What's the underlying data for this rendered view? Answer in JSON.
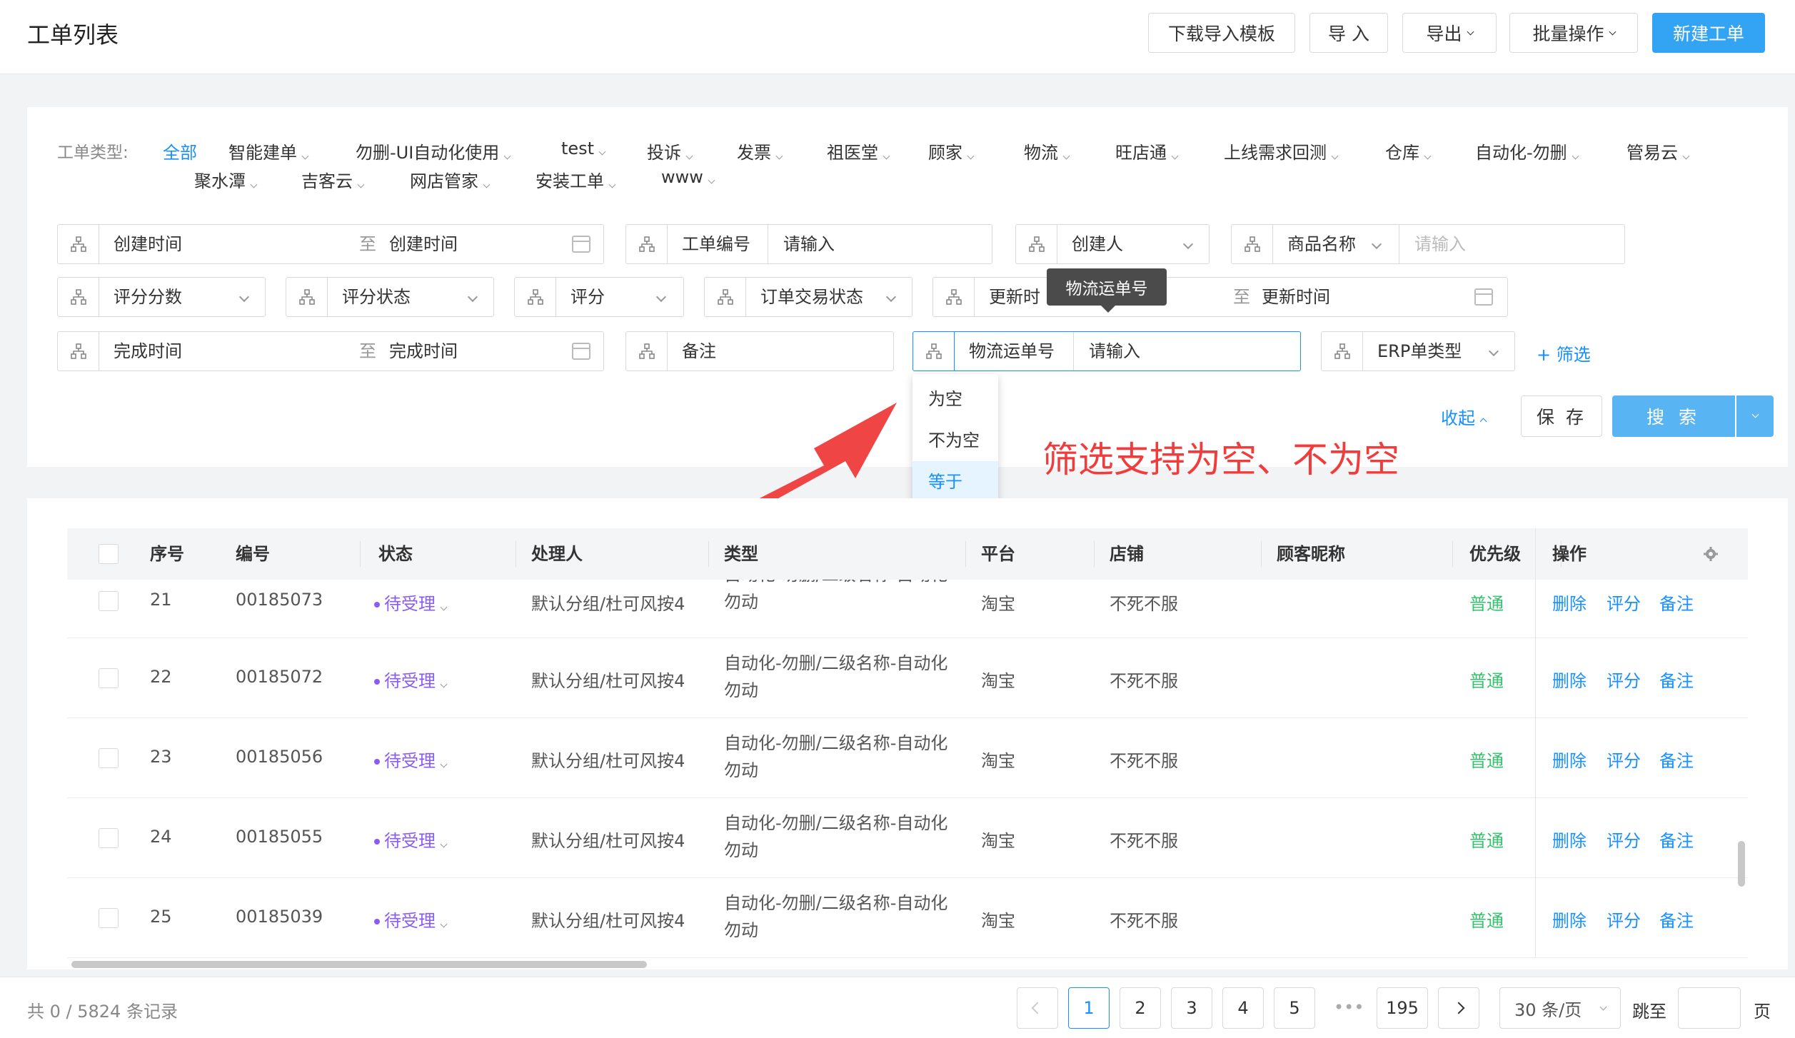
{
  "header": {
    "title": "工单列表",
    "buttons": {
      "download_template": "下载导入模板",
      "import": "导 入",
      "export": "导出",
      "batch": "批量操作",
      "new_ticket": "新建工单"
    }
  },
  "filters": {
    "type_label": "工单类型:",
    "types": [
      "全部",
      "智能建单",
      "勿删-UI自动化使用",
      "test",
      "投诉",
      "发票",
      "祖医堂",
      "顾家",
      "物流",
      "旺店通",
      "上线需求回测",
      "仓库",
      "自动化-勿删",
      "管易云",
      "聚水潭",
      "吉客云",
      "网店管家",
      "安装工单",
      "www"
    ],
    "created_time_start": "创建时间",
    "to": "至",
    "created_time_end": "创建时间",
    "ticket_no_label": "工单编号",
    "input_placeholder": "请输入",
    "creator": "创建人",
    "product_name": "商品名称",
    "product_placeholder": "请输入",
    "score_value": "评分分数",
    "score_status": "评分状态",
    "score": "评分",
    "order_status": "订单交易状态",
    "update_time_start": "更新时",
    "update_time_end": "更新时间",
    "finish_time_start": "完成时间",
    "finish_time_end": "完成时间",
    "remark": "备注",
    "logistics_no_label": "物流运单号",
    "logistics_placeholder": "请输入",
    "erp_type": "ERP单类型",
    "add_filter": "+ 筛选",
    "collapse": "收起",
    "save": "保 存",
    "search": "搜 索"
  },
  "tooltip": "物流运单号",
  "dropdown": {
    "options": [
      "为空",
      "不为空",
      "等于"
    ],
    "selected": "等于"
  },
  "annotation": "筛选支持为空、不为空",
  "table": {
    "columns": [
      "序号",
      "编号",
      "状态",
      "处理人",
      "类型",
      "平台",
      "店铺",
      "顾客昵称",
      "优先级",
      "操作"
    ],
    "rows": [
      {
        "seq": "21",
        "no": "00185073",
        "status": "待受理",
        "handler": "默认分组/杜可风按4",
        "type": "自动化-勿删/二级名称-自动化勿动",
        "platform": "淘宝",
        "shop": "不死不服",
        "priority": "普通"
      },
      {
        "seq": "22",
        "no": "00185072",
        "status": "待受理",
        "handler": "默认分组/杜可风按4",
        "type": "自动化-勿删/二级名称-自动化勿动",
        "platform": "淘宝",
        "shop": "不死不服",
        "priority": "普通"
      },
      {
        "seq": "23",
        "no": "00185056",
        "status": "待受理",
        "handler": "默认分组/杜可风按4",
        "type": "自动化-勿删/二级名称-自动化勿动",
        "platform": "淘宝",
        "shop": "不死不服",
        "priority": "普通"
      },
      {
        "seq": "24",
        "no": "00185055",
        "status": "待受理",
        "handler": "默认分组/杜可风按4",
        "type": "自动化-勿删/二级名称-自动化勿动",
        "platform": "淘宝",
        "shop": "不死不服",
        "priority": "普通"
      },
      {
        "seq": "25",
        "no": "00185039",
        "status": "待受理",
        "handler": "默认分组/杜可风按4",
        "type": "自动化-勿删/二级名称-自动化勿动",
        "platform": "淘宝",
        "shop": "不死不服",
        "priority": "普通"
      }
    ],
    "actions": [
      "删除",
      "评分",
      "备注"
    ]
  },
  "footer": {
    "record_count": "共 0 / 5824 条记录",
    "pages": [
      "1",
      "2",
      "3",
      "4",
      "5"
    ],
    "ellipsis": "•••",
    "last_page": "195",
    "page_size": "30 条/页",
    "jump_label": "跳至",
    "page_unit": "页"
  },
  "colors": {
    "primary": "#1890ff",
    "button_primary": "#33a3f4",
    "status_purple": "#8a5cf6",
    "priority_green": "#34c26e",
    "annotation_red": "#f03c3c"
  }
}
